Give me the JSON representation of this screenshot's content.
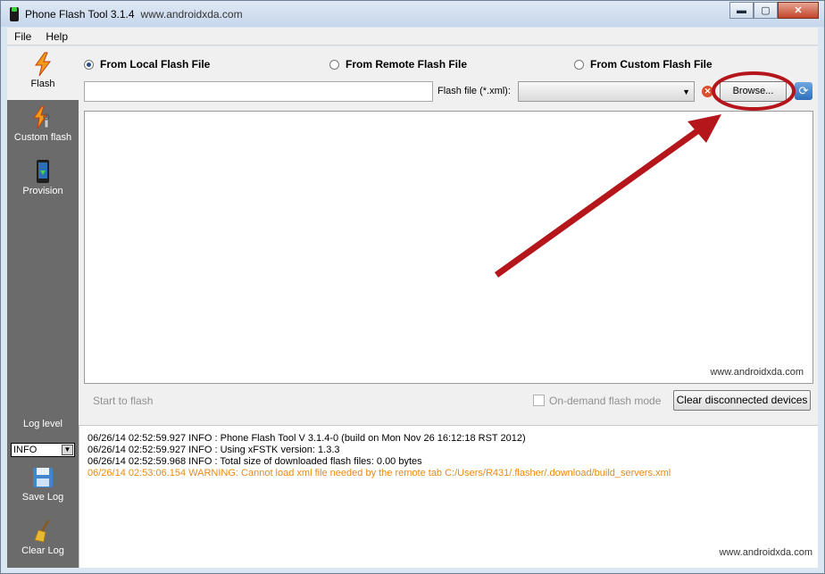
{
  "window": {
    "title": "Phone Flash Tool 3.1.4",
    "subtitle": "www.androidxda.com",
    "minimize": "▬",
    "maximize": "▢",
    "close": "✕"
  },
  "menu": [
    "File",
    "Help"
  ],
  "sidebar": {
    "items": [
      {
        "label": "Flash",
        "icon": "lightning-icon"
      },
      {
        "label": "Custom flash",
        "icon": "custom-flash-icon"
      },
      {
        "label": "Provision",
        "icon": "phone-download-icon"
      }
    ],
    "log_level_label": "Log level",
    "log_level_value": "INFO",
    "save_log": "Save Log",
    "clear_log": "Clear Log"
  },
  "source_options": {
    "local": "From Local Flash File",
    "remote": "From Remote Flash File",
    "custom": "From Custom Flash File",
    "selected": "local"
  },
  "file_row": {
    "path_value": "",
    "flash_file_label": "Flash file (*.xml):",
    "flash_file_value": "",
    "browse_label": "Browse..."
  },
  "content": {
    "watermark": "www.androidxda.com"
  },
  "controls": {
    "start_flash": "Start to flash",
    "on_demand": "On-demand flash mode",
    "clear_devices": "Clear disconnected devices"
  },
  "log": {
    "lines": [
      {
        "text": "06/26/14 02:52:59.927  INFO   : Phone Flash Tool V 3.1.4-0 (build on Mon Nov 26 16:12:18 RST 2012)",
        "level": "info"
      },
      {
        "text": "06/26/14 02:52:59.927  INFO   : Using xFSTK version: 1.3.3",
        "level": "info"
      },
      {
        "text": "06/26/14 02:52:59.968  INFO   : Total size of downloaded flash files: 0.00 bytes",
        "level": "info"
      },
      {
        "text": "06/26/14 02:53:06.154  WARNING: Cannot load xml file needed by the remote tab C:/Users/R431/.flasher/.download/build_servers.xml",
        "level": "warning"
      }
    ],
    "watermark": "www.androidxda.com"
  },
  "colors": {
    "sidebar_bg": "#6b6b6b",
    "warning_text": "#e88a14",
    "annotation_red": "#b5161b"
  }
}
